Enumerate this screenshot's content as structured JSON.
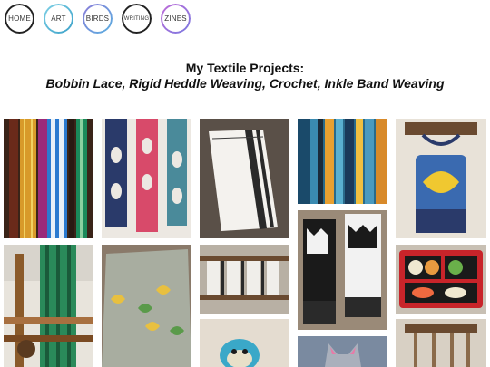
{
  "nav": {
    "items": [
      {
        "label": "HOME",
        "ring": "#222222"
      },
      {
        "label": "ART",
        "ring": "linear-gradient(135deg,#7fd1e6,#3aa0c8)"
      },
      {
        "label": "BIRDS",
        "ring": "linear-gradient(135deg,#8a7ad8,#5ab0e0)"
      },
      {
        "label": "WRITING",
        "ring": "#222222"
      },
      {
        "label": "ZINES",
        "ring": "linear-gradient(135deg,#c06ad8,#7a7ae0)"
      }
    ]
  },
  "page": {
    "title_line1": "My Textile Projects:",
    "title_line2": "Bobbin Lace, Rigid Heddle Weaving, Crochet, Inkle Band Weaving"
  },
  "gallery": {
    "photos": [
      {
        "subject": "inkle-band-weaving"
      },
      {
        "subject": "bobbin-lace-bands"
      },
      {
        "subject": "woven-white-towel"
      },
      {
        "subject": "colorful-warp-threads"
      },
      {
        "subject": "crochet-tote-bag"
      },
      {
        "subject": "loom-with-heddle"
      },
      {
        "subject": "crochet-sweater-leaves"
      },
      {
        "subject": "rigid-heddle-loom-warp"
      },
      {
        "subject": "crochet-heart-mittens"
      },
      {
        "subject": "crochet-sushi-bento"
      },
      {
        "subject": "crochet-blue-bird"
      },
      {
        "subject": "crochet-cat-toy"
      },
      {
        "subject": "wall-hanging-rack"
      }
    ]
  }
}
